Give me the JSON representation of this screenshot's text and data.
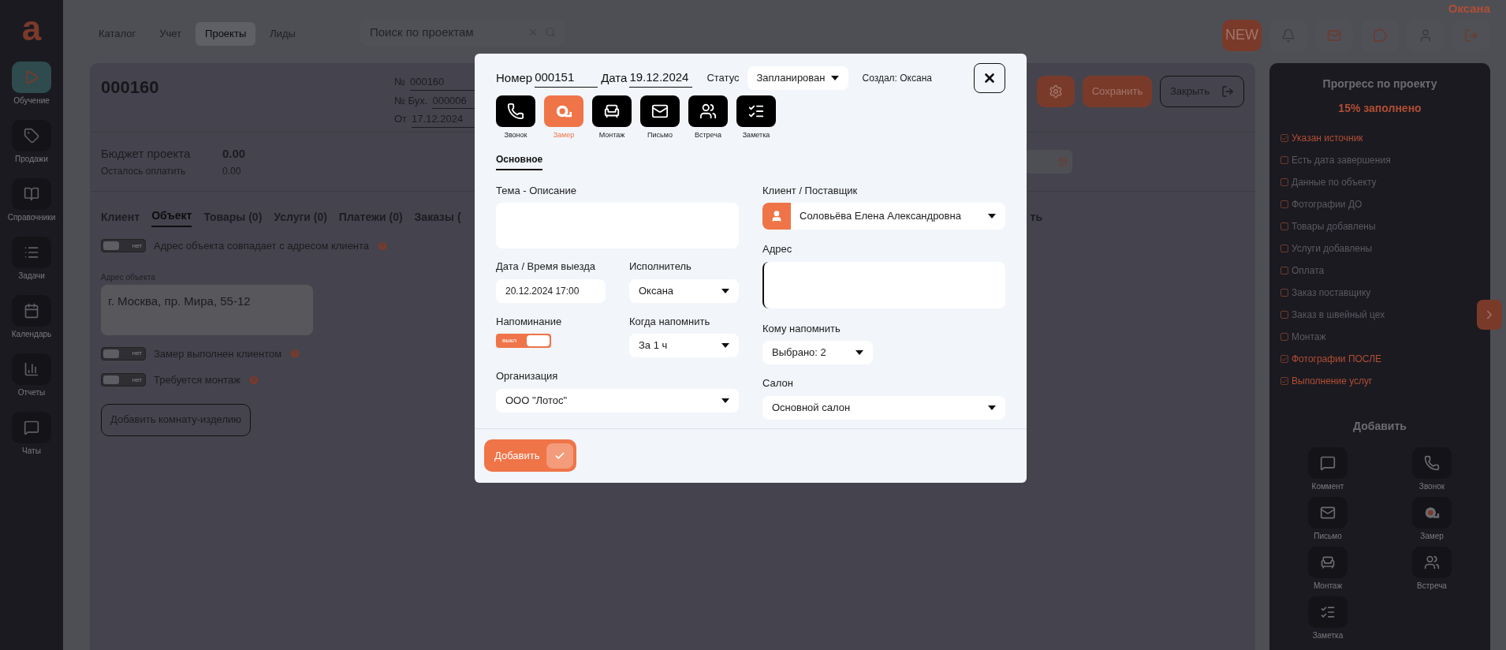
{
  "sidebar": {
    "logo": "a",
    "items": [
      {
        "label": "Обучение",
        "kind": "play",
        "selected": true
      },
      {
        "label": "Продажи",
        "kind": "tag",
        "selected": false
      },
      {
        "label": "Справочники",
        "kind": "book",
        "selected": false
      },
      {
        "label": "Задачи",
        "kind": "list",
        "selected": false
      },
      {
        "label": "Календарь",
        "kind": "calendar",
        "selected": false
      },
      {
        "label": "Отчеты",
        "kind": "chart",
        "selected": false
      },
      {
        "label": "Чаты",
        "kind": "chat",
        "selected": false
      }
    ]
  },
  "top_nav": {
    "tabs": [
      {
        "label": "Каталог",
        "selected": false
      },
      {
        "label": "Учет",
        "selected": false
      },
      {
        "label": "Проекты",
        "selected": true
      },
      {
        "label": "Лиды",
        "selected": false
      }
    ],
    "search": {
      "placeholder": "Поиск по проектам"
    },
    "user_name": "Оксана",
    "new_badge": "NEW"
  },
  "project": {
    "title": "000160",
    "number_label": "№",
    "number": "000160",
    "acc_label": "№ Бух.",
    "acc_number": "000006",
    "date_label": "От",
    "date": "17.12.2024",
    "save_button": "Сохранить",
    "close_button": "Закрыть",
    "budget_label": "Бюджет проекта",
    "budget": "0.00",
    "remaining_label": "Осталось оплатить",
    "remaining": "0.00",
    "tabs": [
      {
        "label": "Клиент",
        "selected": false
      },
      {
        "label": "Объект",
        "selected": true
      },
      {
        "label": "Товары (0)",
        "selected": false
      },
      {
        "label": "Услуги (0)",
        "selected": false
      },
      {
        "label": "Платежи (0)",
        "selected": false
      },
      {
        "label": "Заказы (",
        "selected": false
      }
    ],
    "tab_fragment": "ть",
    "object_fields": [
      {
        "kind": "toggle",
        "label": "Адрес объекта совпадает с адресом клиента",
        "state_text": "нет",
        "on": false
      },
      {
        "kind": "textarea",
        "label": "Адрес объекта",
        "value": "г. Москва, пр. Мира, 55-12"
      },
      {
        "kind": "toggle",
        "label": "Замер выполнен клиентом",
        "state_text": "нет",
        "on": false
      },
      {
        "kind": "toggle",
        "label": "Требуется монтаж",
        "state_text": "нет",
        "on": false
      }
    ],
    "add_room_button": "Добавить комнату-изделию"
  },
  "progress": {
    "title": "Прогресс по проекту",
    "percent_text": "15% заполнено",
    "items": [
      {
        "label": "Указан источник",
        "checked": true
      },
      {
        "label": "Есть дата завершения",
        "checked": false
      },
      {
        "label": "Данные по объекту",
        "checked": false
      },
      {
        "label": "Фотографии ДО",
        "checked": false
      },
      {
        "label": "Товары добавлены",
        "checked": false
      },
      {
        "label": "Услуги добавлены",
        "checked": false
      },
      {
        "label": "Оплата",
        "checked": false
      },
      {
        "label": "Заказ поставщику",
        "checked": false
      },
      {
        "label": "Заказ в швейный цех",
        "checked": false
      },
      {
        "label": "Монтаж",
        "checked": false
      },
      {
        "label": "Фотографии ПОСЛЕ",
        "checked": true
      },
      {
        "label": "Выполнение услуг",
        "checked": true
      }
    ],
    "add_title": "Добавить",
    "add_items": [
      {
        "label": "Коммент",
        "kind": "comment"
      },
      {
        "label": "Звонок",
        "kind": "call"
      },
      {
        "label": "Письмо",
        "kind": "mail"
      },
      {
        "label": "Замер",
        "kind": "measure"
      },
      {
        "label": "Монтаж",
        "kind": "install"
      },
      {
        "label": "Встреча",
        "kind": "meeting"
      },
      {
        "label": "Заметка",
        "kind": "note"
      }
    ]
  },
  "modal": {
    "number_label": "Номер",
    "number": "000151",
    "date_label": "Дата",
    "date": "19.12.2024",
    "status_label": "Статус",
    "status": "Запланирован",
    "created_by": "Создал: Оксана",
    "types": [
      {
        "label": "Звонок",
        "kind": "call",
        "selected": false
      },
      {
        "label": "Замер",
        "kind": "measure",
        "selected": true
      },
      {
        "label": "Монтаж",
        "kind": "install",
        "selected": false
      },
      {
        "label": "Письмо",
        "kind": "mail",
        "selected": false
      },
      {
        "label": "Встреча",
        "kind": "meeting",
        "selected": false
      },
      {
        "label": "Заметка",
        "kind": "note",
        "selected": false
      }
    ],
    "section_tab": "Основное",
    "topic": {
      "label": "Тема - Описание"
    },
    "client": {
      "label": "Клиент / Поставщик",
      "value": "Соловьёва Елена Александровна"
    },
    "address": {
      "label": "Адрес"
    },
    "datetime": {
      "label": "Дата / Время выезда",
      "value": "20.12.2024 17:00"
    },
    "executor": {
      "label": "Исполнитель",
      "value": "Оксана"
    },
    "reminder": {
      "label": "Напоминание",
      "state_text": "выкл",
      "on": false
    },
    "when": {
      "label": "Когда напомнить",
      "value": "За 1 ч"
    },
    "whom": {
      "label": "Кому напомнить",
      "value": "Выбрано: 2"
    },
    "organization": {
      "label": "Организация",
      "value": "ООО \"Лотос\""
    },
    "salon": {
      "label": "Салон",
      "value": "Основной салон"
    },
    "submit": "Добавить"
  }
}
